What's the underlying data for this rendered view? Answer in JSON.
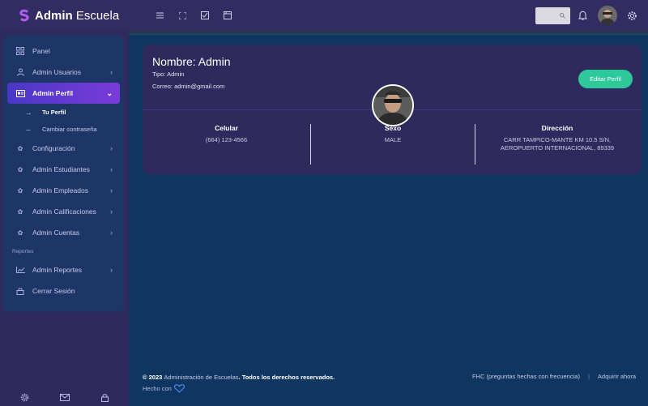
{
  "brand": {
    "bold": "Admin",
    "rest": " Escuela"
  },
  "colors": {
    "accent": "#2ec99a",
    "sidebar_active_start": "#4a37c7",
    "sidebar_active_end": "#7a3bd9",
    "main_bg": "#0f3561",
    "card_bg": "#2f2a5e"
  },
  "navbar": {
    "tools": [
      "menu-icon",
      "fullscreen-icon",
      "checklist-icon",
      "window-icon"
    ],
    "search_icon": "search-icon"
  },
  "sidebar": {
    "panel": "Panel",
    "usuarios": "Admin Usuarios",
    "perfil": "Admin Perfil",
    "tu_perfil": "Tu Perfil",
    "cambiar": "Cambiar contraseña",
    "configuracion": "Configuración",
    "estudiantes": "Admin Estudiantes",
    "empleados": "Admin Empleados",
    "calificaciones": "Admin Calificaciones",
    "cuentas": "Admin Cuentas",
    "reportes_heading": "Reportes",
    "reportes": "Admin Reportes",
    "cerrar": "Cerrar Sesión"
  },
  "profile": {
    "nombre": "Nombre: Admin",
    "tipo": "Tipo: Admin",
    "correo": "Correo: admin@gmail.com",
    "edit_label": "Editar Perfil",
    "celular_label": "Celular",
    "celular_value": "(664) 123-4566",
    "sexo_label": "Sexo",
    "sexo_value": "MALE",
    "direccion_label": "Dirección",
    "direccion_line1": "CARR TAMPICO-MANTE KM 10.5 S/N,",
    "direccion_line2": "AEROPUERTO INTERNACIONAL, 89339"
  },
  "footer": {
    "copyright_prefix": "© 2023 ",
    "copyright_name": "Administración de Escuelas",
    "copyright_suffix": ". Todos los derechos reservados.",
    "made_with": "Hecho con",
    "faq": "FHC (preguntas hechas con frecuencia)",
    "separator": "|",
    "buy": "Adquirir ahora"
  }
}
